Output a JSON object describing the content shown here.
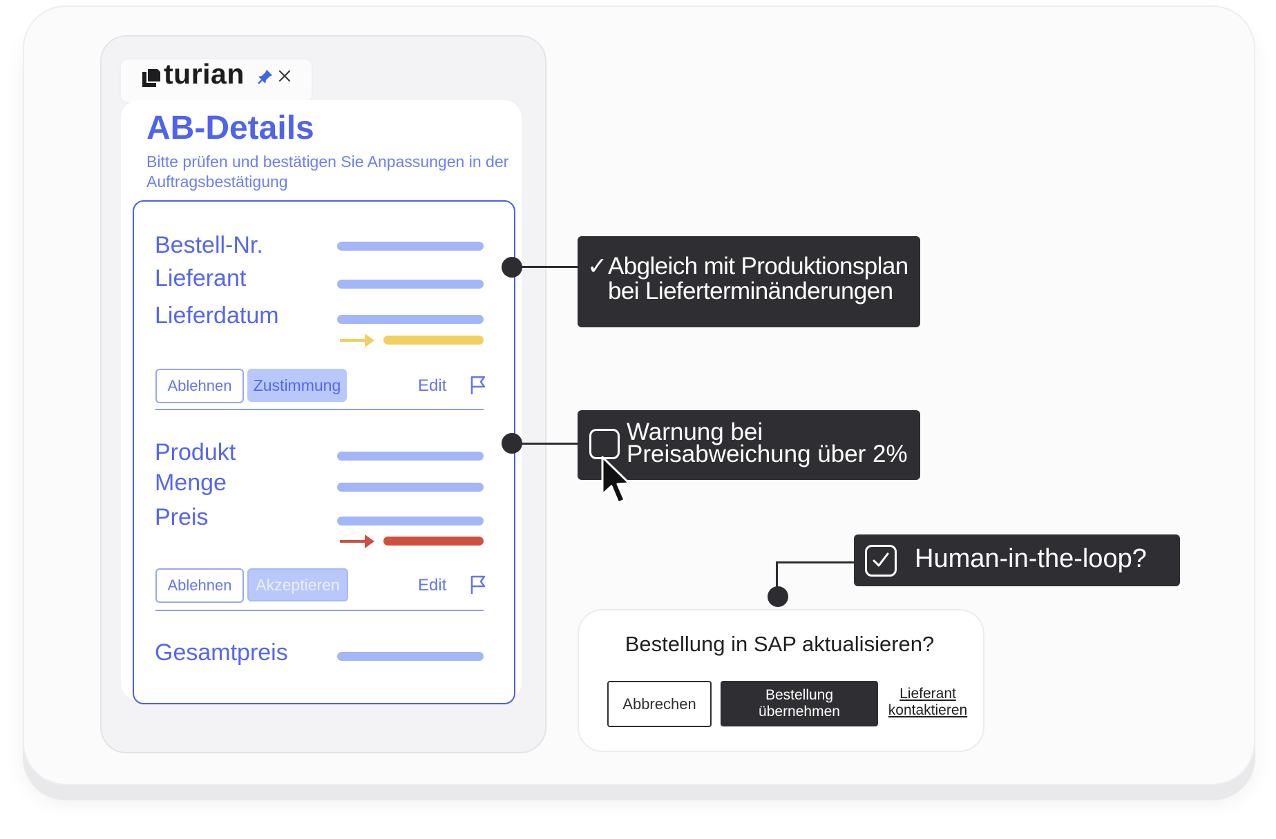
{
  "app": {
    "logo_text": "turian"
  },
  "panel": {
    "title": "AB-Details",
    "subtitle": "Bitte prüfen und bestätigen Sie Anpassungen in der Auftragsbestätigung",
    "section1": {
      "labels": [
        "Bestell-Nr.",
        "Lieferant",
        "Lieferdatum"
      ],
      "reject": "Ablehnen",
      "approve": "Zustimmung",
      "edit": "Edit"
    },
    "section2": {
      "labels": [
        "Produkt",
        "Menge",
        "Preis"
      ],
      "reject": "Ablehnen",
      "approve": "Akzeptieren",
      "edit": "Edit"
    },
    "total_label": "Gesamtpreis"
  },
  "callouts": {
    "check_mark": "✓",
    "sync_line1": "Abgleich mit Produktionsplan",
    "sync_line2": "bei Lieferterminänderungen",
    "warn_line1": "Warnung bei",
    "warn_line2": "Preisabweichung über 2%",
    "hitl": "Human-in-the-loop?"
  },
  "dialog": {
    "question": "Bestellung in SAP aktualisieren?",
    "cancel": "Abbrechen",
    "confirm_line1": "Bestellung",
    "confirm_line2": "übernehmen",
    "contact_line1": "Lieferant",
    "contact_line2": "kontaktieren"
  },
  "colors": {
    "accent": "#4f63ee",
    "bar": "#a3b6f7",
    "change_yellow": "#f2cf61",
    "change_red": "#d0503f",
    "dark": "#2f2f33"
  }
}
